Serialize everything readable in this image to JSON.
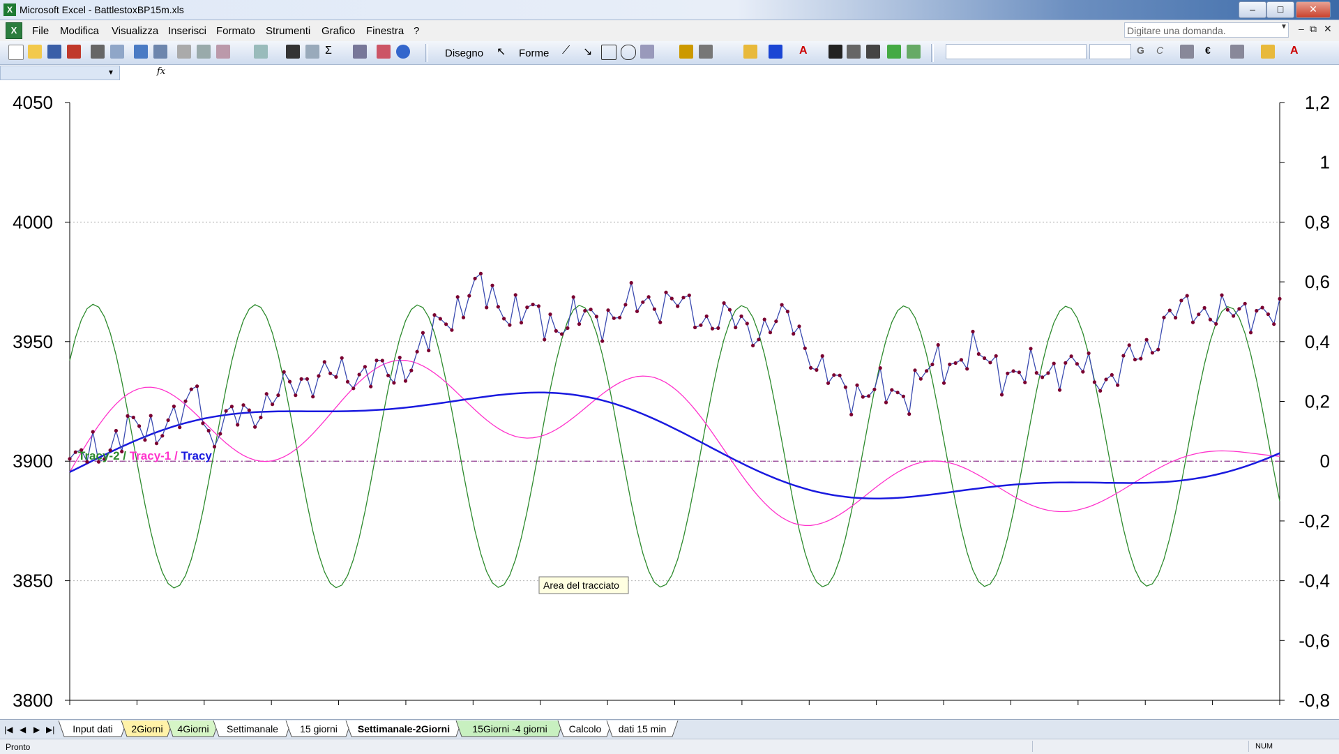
{
  "window": {
    "title": "Microsoft Excel - BattlestoxBP15m.xls"
  },
  "menu": [
    "File",
    "Modifica",
    "Visualizza",
    "Inserisci",
    "Formato",
    "Strumenti",
    "Grafico",
    "Finestra",
    "?"
  ],
  "ask_placeholder": "Digitare una domanda.",
  "toolbar": {
    "draw_label": "Disegno",
    "shapes_label": "Forme"
  },
  "chart_data": {
    "type": "line",
    "legend_text": {
      "part1": "Tracy-2",
      "sep1": " / ",
      "part2": "Tracy-1",
      "sep2": " / ",
      "part3": "Tracy"
    },
    "colors": {
      "price": "#7a0030",
      "price_line": "#3b4bb0",
      "tracy2": "#2e8b2e",
      "tracy1": "#ff33cc",
      "tracy": "#1a1adf",
      "zero": "#8b2a8b"
    },
    "y_left": {
      "min": 3800,
      "max": 4050,
      "ticks": [
        "4050",
        "4000",
        "3950",
        "3900",
        "3850",
        "3800"
      ]
    },
    "y_right": {
      "min": -0.8,
      "max": 1.2,
      "ticks": [
        "1,2",
        "1",
        "0,8",
        "0,6",
        "0,4",
        "0,2",
        "0",
        "-0,2",
        "-0,4",
        "-0,6",
        "-0,8"
      ]
    },
    "grid": true,
    "n_points": 210,
    "price_keys": [
      [
        0,
        3898
      ],
      [
        5,
        3905
      ],
      [
        10,
        3912
      ],
      [
        15,
        3915
      ],
      [
        20,
        3918
      ],
      [
        22,
        3935
      ],
      [
        24,
        3910
      ],
      [
        30,
        3920
      ],
      [
        35,
        3925
      ],
      [
        40,
        3935
      ],
      [
        45,
        3935
      ],
      [
        50,
        3938
      ],
      [
        55,
        3935
      ],
      [
        60,
        3945
      ],
      [
        62,
        3950
      ],
      [
        65,
        3960
      ],
      [
        70,
        3972
      ],
      [
        75,
        3965
      ],
      [
        80,
        3960
      ],
      [
        85,
        3958
      ],
      [
        90,
        3960
      ],
      [
        95,
        3962
      ],
      [
        100,
        3968
      ],
      [
        105,
        3965
      ],
      [
        110,
        3960
      ],
      [
        115,
        3958
      ],
      [
        120,
        3955
      ],
      [
        125,
        3960
      ],
      [
        130,
        3935
      ],
      [
        135,
        3930
      ],
      [
        140,
        3928
      ],
      [
        145,
        3930
      ],
      [
        150,
        3940
      ],
      [
        155,
        3945
      ],
      [
        160,
        3940
      ],
      [
        165,
        3935
      ],
      [
        170,
        3940
      ],
      [
        175,
        3938
      ],
      [
        180,
        3935
      ],
      [
        185,
        3945
      ],
      [
        190,
        3960
      ],
      [
        195,
        3965
      ],
      [
        200,
        3960
      ],
      [
        205,
        3965
      ],
      [
        210,
        3955
      ]
    ],
    "note": "",
    "tooltip": "Area del tracciato"
  },
  "sheet_tabs": [
    "Input dati",
    "2Giorni",
    "4Giorni",
    "Settimanale",
    "15 giorni",
    "Settimanale-2Giorni",
    "15Giorni -4 giorni",
    "Calcolo",
    "dati 15 min"
  ],
  "active_tab": "Settimanale-2Giorni",
  "status": {
    "left": "Pronto",
    "num": "NUM"
  }
}
